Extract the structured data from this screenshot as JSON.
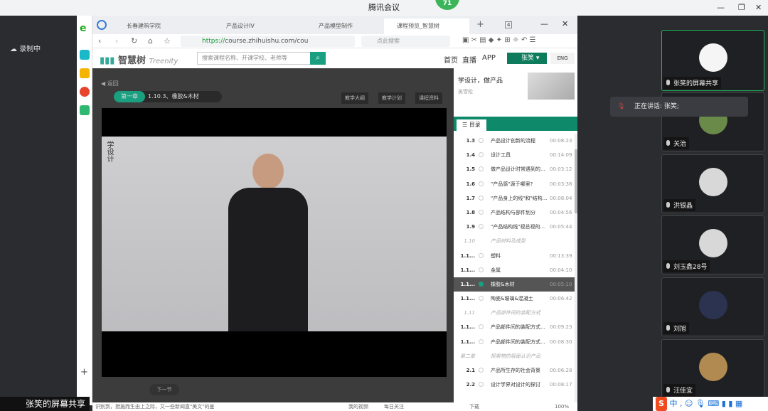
{
  "meeting": {
    "title": "腾讯会议",
    "badge": "71",
    "recording": "录制中",
    "speaking": "正在讲话: 张笑;",
    "share_label": "张笑的屏幕共享"
  },
  "participants": [
    {
      "name": "张笑的屏幕共享",
      "avatar_color": "#f5f5f5"
    },
    {
      "name": "关治",
      "avatar_color": "#6a8a4a"
    },
    {
      "name": "洪银晶",
      "avatar_color": "#d8d8d8"
    },
    {
      "name": "刘玉鑫28号",
      "avatar_color": "#d8d8d8"
    },
    {
      "name": "刘旭",
      "avatar_color": "#2c3350"
    },
    {
      "name": "汪佳宜",
      "avatar_color": "#b08a50"
    }
  ],
  "browser": {
    "tabs": [
      "长春建筑学院",
      "产品设计IV",
      "产品模型制作",
      "课程预览_智慧树"
    ],
    "url_scheme": "https://",
    "url_rest": "course.zhihuishu.com/cou",
    "search_placeholder": "点此搜索",
    "tab_count": "4"
  },
  "site": {
    "logo": "智慧树",
    "logo2": "Treenity",
    "search_placeholder": "搜索课程名称、开课学校、老师等",
    "nav": [
      "首页",
      "直播",
      "APP"
    ],
    "user": "张笑",
    "lang": "ENG"
  },
  "player": {
    "back": "返回",
    "chapter": "第一章",
    "lesson": "1.10.3、橡胶&木材",
    "buttons": [
      "教学大纲",
      "教学计划",
      "课程资料"
    ],
    "next": "下一节",
    "video_caption": "学设计"
  },
  "panel": {
    "course_title": "学设计，做产品",
    "teacher": "吴雪松",
    "tab": "目录",
    "items": [
      {
        "n": "1.3",
        "t": "产品设计创新的流程",
        "d": "00:08:23"
      },
      {
        "n": "1.4",
        "t": "设计工具",
        "d": "00:14:09"
      },
      {
        "n": "1.5",
        "t": "做产品设计时常遇到的...",
        "d": "00:03:12"
      },
      {
        "n": "1.6",
        "t": "\"产品感\"源于哪里?",
        "d": "00:03:38"
      },
      {
        "n": "1.7",
        "t": "\"产品身上的线\"和\"结构...",
        "d": "00:08:04"
      },
      {
        "n": "1.8",
        "t": "产品结构与部件划分",
        "d": "00:04:56"
      },
      {
        "n": "1.9",
        "t": "\"产品结构线\"视总视的...",
        "d": "00:05:44"
      },
      {
        "n": "1.10",
        "t": "产品材料及成型",
        "d": "",
        "sec": true
      },
      {
        "n": "1.1...",
        "t": "塑料",
        "d": "00:13:39"
      },
      {
        "n": "1.1...",
        "t": "金属",
        "d": "00:04:10"
      },
      {
        "n": "1.1...",
        "t": "橡胶&木材",
        "d": "00:05:10",
        "active": true
      },
      {
        "n": "1.1...",
        "t": "陶瓷&玻璃&混凝土",
        "d": "00:06:42"
      },
      {
        "n": "1.11",
        "t": "产品部件间的装配方式",
        "d": "",
        "sec": true
      },
      {
        "n": "1.1...",
        "t": "产品部件间的装配方式...",
        "d": "00:09:23"
      },
      {
        "n": "1.1...",
        "t": "产品部件间的装配方式...",
        "d": "00:08:30"
      },
      {
        "n": "第二章",
        "t": "探索物的层面认识产品",
        "d": "",
        "sec": true
      },
      {
        "n": "2.1",
        "t": "产品所生存的社会背景",
        "d": "00:06:28"
      },
      {
        "n": "2.2",
        "t": "设计学界对设计的探讨",
        "d": "00:08:17"
      }
    ]
  },
  "statusbar": {
    "text": "识别到，措施而生由上之际，又一些新闻直\"美文\"的鉴",
    "items": [
      "我的视频",
      "每日关注",
      "下载"
    ],
    "zoom": "100%"
  },
  "ime": {
    "logo": "S",
    "mode": "中"
  },
  "colors": {
    "accent": "#1aa080",
    "active_border": "#1fb45a"
  }
}
